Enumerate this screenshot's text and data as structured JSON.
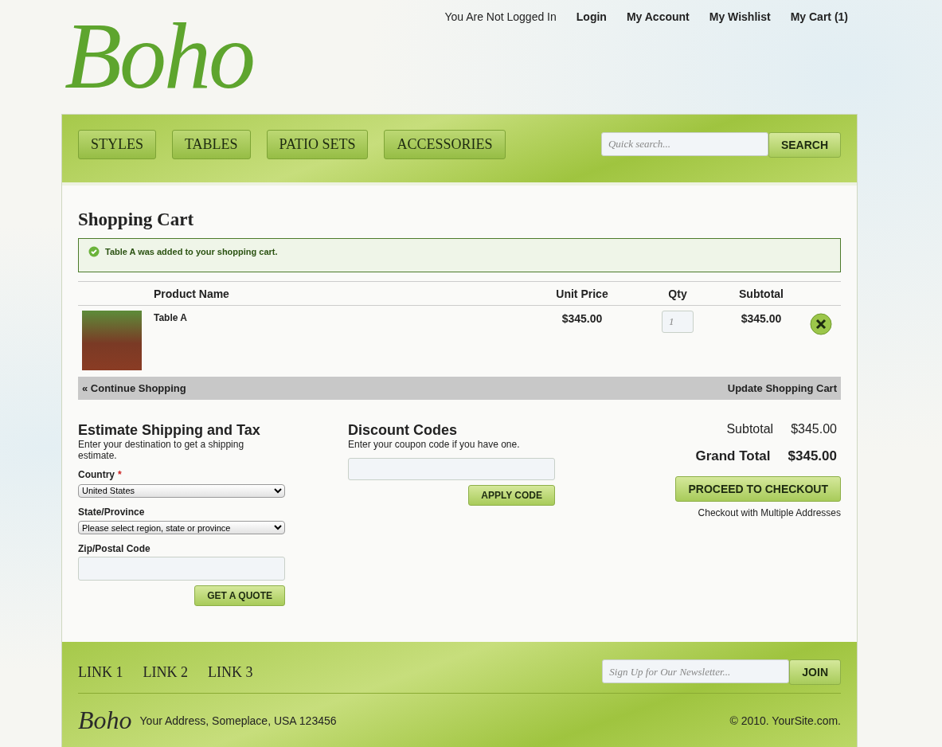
{
  "top_links": [
    {
      "label": "You Are Not Logged In",
      "kind": "text"
    },
    {
      "label": "Login",
      "kind": "link"
    },
    {
      "label": "My Account",
      "kind": "link"
    },
    {
      "label": "My Wishlist",
      "kind": "link"
    },
    {
      "label": "My Cart (1)",
      "kind": "link"
    }
  ],
  "logo": "Boho",
  "nav": [
    "STYLES",
    "TABLES",
    "PATIO SETS",
    "ACCESSORIES"
  ],
  "search": {
    "placeholder": "Quick search...",
    "button": "SEARCH"
  },
  "page_title": "Shopping Cart",
  "message": "Table A was added to your shopping cart.",
  "cart": {
    "columns": [
      "Product Name",
      "Unit Price",
      "Qty",
      "Subtotal"
    ],
    "rows": [
      {
        "name": "Table A",
        "unit_price": "$345.00",
        "qty": "1",
        "subtotal": "$345.00"
      }
    ],
    "continue": "« Continue Shopping",
    "update": "Update Shopping Cart"
  },
  "shipping": {
    "title": "Estimate Shipping and Tax",
    "intro": "Enter your destination to get a shipping estimate.",
    "fields": [
      {
        "label": "Country",
        "required_mark": "*",
        "kind": "select",
        "value": "United States"
      },
      {
        "label": "State/Province",
        "kind": "select",
        "value": "Please select region, state or province"
      },
      {
        "label": "Zip/Postal Code",
        "kind": "input"
      }
    ],
    "button": "GET A QUOTE"
  },
  "discount": {
    "title": "Discount Codes",
    "intro": "Enter your coupon code if you have one.",
    "button": "APPLY CODE"
  },
  "totals": [
    {
      "label": "Subtotal",
      "value": "$345.00",
      "kind": "normal"
    },
    {
      "label": "Grand Total",
      "value": "$345.00",
      "kind": "grand"
    }
  ],
  "checkout": {
    "button": "PROCEED TO CHECKOUT",
    "link": "Checkout with Multiple Addresses"
  },
  "footer": {
    "links": [
      "LINK 1",
      "LINK 2",
      "LINK 3"
    ],
    "newsletter_placeholder": "Sign Up for Our Newsletter...",
    "join": "JOIN",
    "logo": "Boho",
    "address": "Your Address, Someplace, USA 123456",
    "copyright": "© 2010. YourSite.com."
  }
}
